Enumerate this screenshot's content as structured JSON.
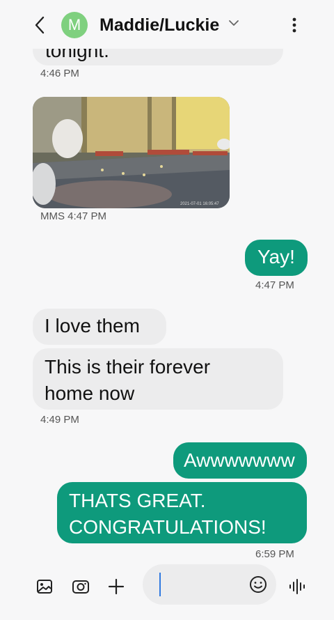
{
  "header": {
    "avatar_letter": "M",
    "title": "Maddie/Luckie"
  },
  "messages": {
    "cut_off_text": "tonight.",
    "cut_off_time": "4:46 PM",
    "mms_label": "MMS 4:47 PM",
    "photo_timestamp": "2021-07-01 16:05:47",
    "yay": "Yay!",
    "yay_time": "4:47 PM",
    "love": "I love them",
    "forever_line1": "This is their forever",
    "forever_line2": "home now",
    "forever_time": "4:49 PM",
    "aww": "Awwwwwww",
    "great_line1": "THATS GREAT.",
    "great_line2": "CONGRATULATIONS!",
    "great_time": "6:59 PM"
  },
  "composer": {
    "input_value": "",
    "icons": [
      "gallery-icon",
      "camera-icon",
      "plus-icon",
      "emoji-icon",
      "voice-icon"
    ]
  },
  "colors": {
    "outgoing": "#0e9a7c",
    "incoming": "#ececed",
    "avatar": "#7fd07f",
    "caret": "#2f79e0"
  }
}
